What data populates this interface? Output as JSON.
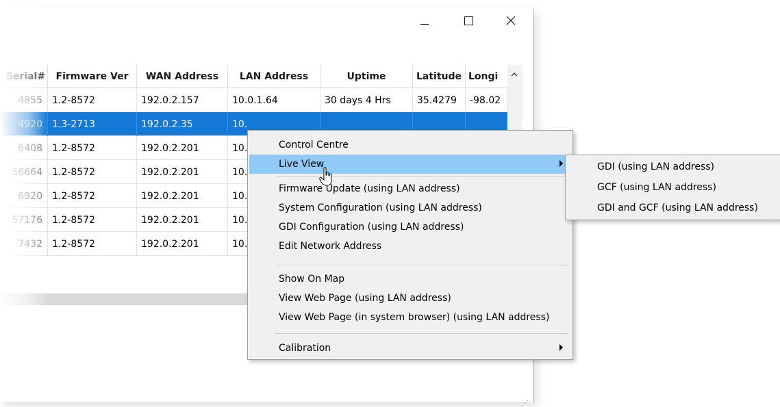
{
  "window": {
    "controls": {
      "minimize": "minimize",
      "maximize": "maximize",
      "close": "close"
    }
  },
  "table": {
    "columns": [
      "Serial#",
      "Firmware Ver",
      "WAN Address",
      "LAN Address",
      "Uptime",
      "Latitude",
      "Longi"
    ],
    "rows": [
      [
        "4855",
        "1.2-8572",
        "192.0.2.157",
        "10.0.1.64",
        "30 days 4 Hrs",
        "35.4279",
        "-98.02"
      ],
      [
        "4920",
        "1.3-2713",
        "192.0.2.35",
        "10.",
        "",
        "",
        ""
      ],
      [
        "6408",
        "1.2-8572",
        "192.0.2.201",
        "10.",
        "",
        "",
        ""
      ],
      [
        "56664",
        "1.2-8572",
        "192.0.2.201",
        "10.",
        "",
        "",
        ""
      ],
      [
        "6920",
        "1.2-8572",
        "192.0.2.201",
        "10.",
        "",
        "",
        ""
      ],
      [
        "57176",
        "1.2-8572",
        "192.0.2.201",
        "10.",
        "",
        "",
        ""
      ],
      [
        "7432",
        "1.2-8572",
        "192.0.2.201",
        "10.",
        "",
        "",
        ""
      ]
    ],
    "selected_row": 1
  },
  "context_menu": {
    "items": [
      {
        "label": "Control Centre"
      },
      {
        "label": "Live View",
        "submenu": true,
        "highlighted": true
      },
      {
        "label": "Firmware Update (using LAN address)"
      },
      {
        "label": "System Configuration (using LAN address)"
      },
      {
        "label": "GDI Configuration (using LAN address)"
      },
      {
        "label": "Edit Network Address"
      },
      {
        "label": "Show On Map"
      },
      {
        "label": "View Web Page (using LAN address)"
      },
      {
        "label": "View Web Page (in system browser) (using LAN address)"
      },
      {
        "label": "Calibration",
        "submenu": true
      }
    ]
  },
  "submenu": {
    "items": [
      "GDI (using LAN address)",
      "GCF (using LAN address)",
      "GDI and GCF (using LAN address)"
    ]
  },
  "colors": {
    "selection": "#1479d6",
    "menu_highlight": "#91c9f7",
    "menu_bg": "#f0f0f0"
  }
}
